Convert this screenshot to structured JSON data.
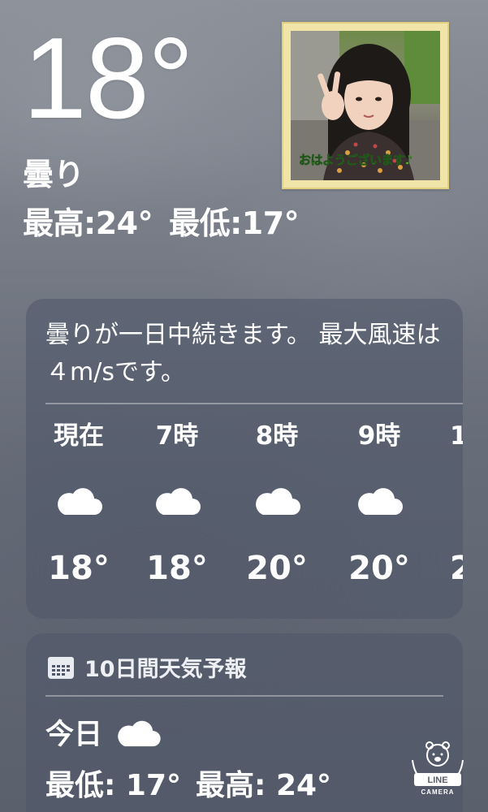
{
  "current": {
    "temperature": "18°",
    "condition": "曇り",
    "high": "最高:24°",
    "low": "最低:17°"
  },
  "photo": {
    "caption": "おはようございます♪"
  },
  "hourly": {
    "summary": "曇りが一日中続きます。 最大風速は４m/sです。",
    "items": [
      {
        "time": "現在",
        "icon": "cloud-icon",
        "temp": "18°"
      },
      {
        "time": "7時",
        "icon": "cloud-icon",
        "temp": "18°"
      },
      {
        "time": "8時",
        "icon": "cloud-icon",
        "temp": "20°"
      },
      {
        "time": "9時",
        "icon": "cloud-icon",
        "temp": "20°"
      },
      {
        "time": "1",
        "icon": "cloud-icon",
        "temp": "2"
      }
    ]
  },
  "daily": {
    "header": "10日間天気予報",
    "today": {
      "name": "今日",
      "icon": "cloud-icon",
      "low": "最低: 17°",
      "high": "最高: 24°"
    }
  },
  "badge": {
    "line1": "LINE",
    "line2": "CAMERA"
  }
}
